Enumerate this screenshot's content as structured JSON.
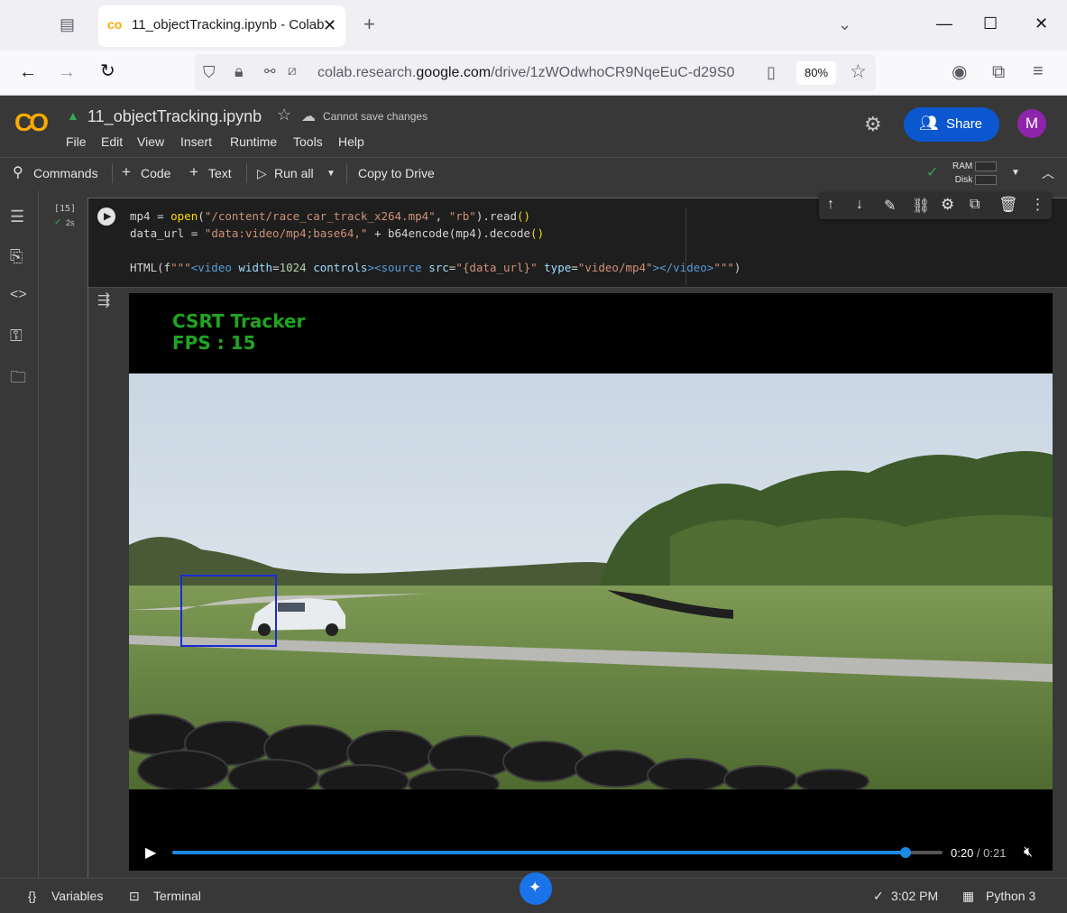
{
  "browser": {
    "tab_title": "11_objectTracking.ipynb - Colab",
    "url_prefix": "colab.research.",
    "url_domain": "google.com",
    "url_path": "/drive/1zWOdwhoCR9NqeEuC-d29S0",
    "zoom": "80%"
  },
  "colab": {
    "logo": "CO",
    "notebook_title": "11_objectTracking.ipynb",
    "save_status": "Cannot save changes",
    "menu": [
      "File",
      "Edit",
      "View",
      "Insert",
      "Runtime",
      "Tools",
      "Help"
    ],
    "share_label": "Share",
    "avatar_letter": "M"
  },
  "toolbar": {
    "commands": "Commands",
    "code": "Code",
    "text": "Text",
    "run_all": "Run all",
    "copy_to_drive": "Copy to Drive",
    "ram": "RAM",
    "disk": "Disk"
  },
  "cell": {
    "exec_count": "[15]",
    "exec_time": "2s",
    "code_lines": [
      "mp4 = open(\"/content/race_car_track_x264.mp4\", \"rb\").read()",
      "data_url = \"data:video/mp4;base64,\" + b64encode(mp4).decode()",
      "",
      "HTML(f\"\"\"<video width=1024 controls><source src=\"{data_url}\" type=\"video/mp4\"></video>\"\"\")"
    ]
  },
  "video": {
    "overlay_line1": "CSRT Tracker",
    "overlay_line2": "FPS : 15",
    "current_time": "0:20",
    "duration": "0:21",
    "progress_fraction": 0.952
  },
  "statusbar": {
    "variables": "Variables",
    "terminal": "Terminal",
    "time": "3:02 PM",
    "runtime": "Python 3"
  },
  "colors": {
    "colab_bg": "#383838",
    "share_blue": "#0b57d0",
    "tracker_green": "#1fa51f",
    "bbox_blue": "#1a2bd6",
    "progress_blue": "#1a8ae6"
  }
}
